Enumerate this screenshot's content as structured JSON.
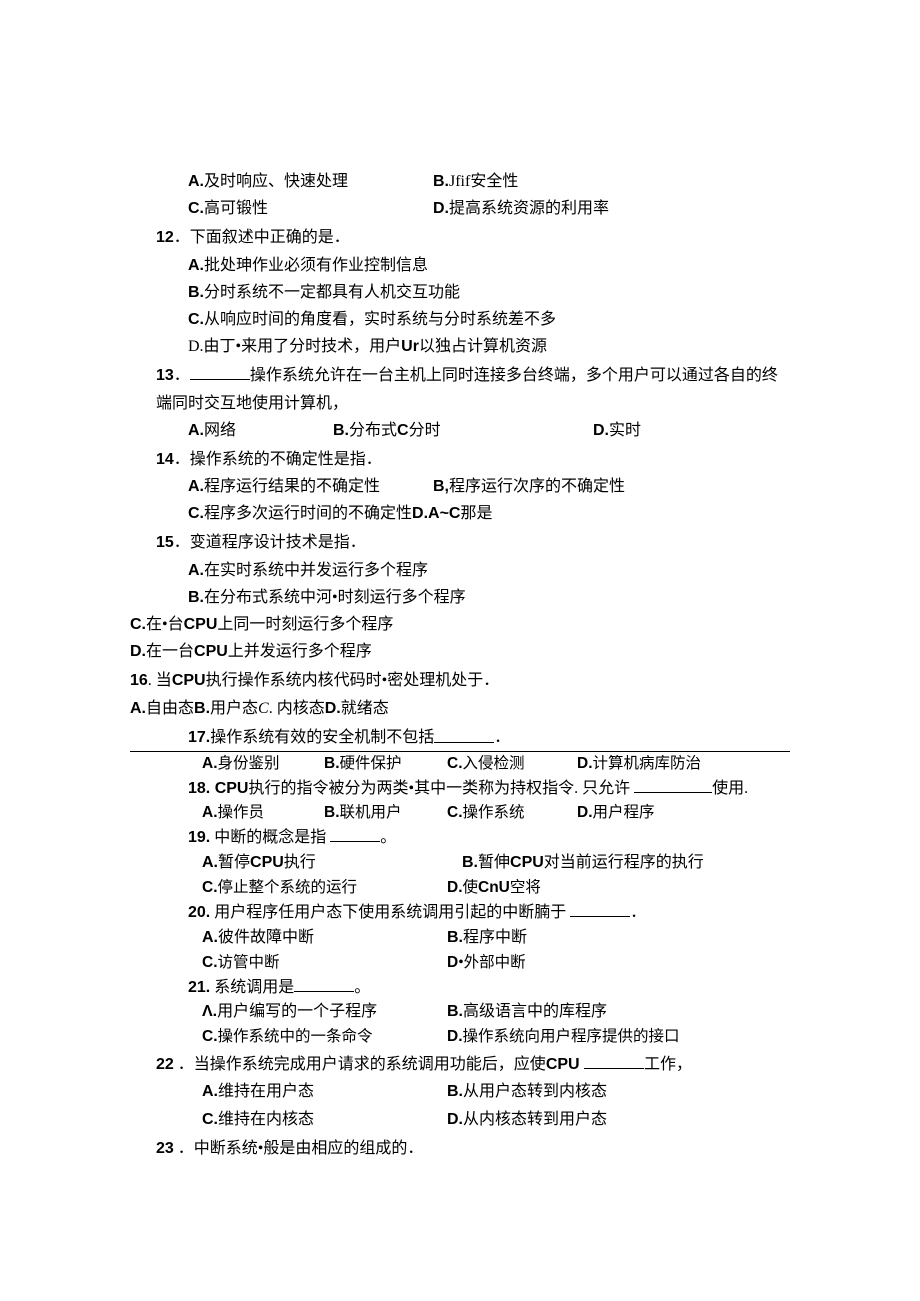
{
  "q11": {
    "optA": "及时响应、快速处理",
    "optB": "Jfif安全性",
    "optC": "高可锻性",
    "optD": "提高系统资源的利用率"
  },
  "q12": {
    "num": "12",
    "stem": "．下面叙述中正确的是．",
    "optA": "批处珅作业必须有作业控制信息",
    "optB": "分时系统不一定都具有人机交互功能",
    "optC": "从响应时间的角度看，实时系统与分时系统差不多",
    "optD_pre": "D.由丁•来用了分时技术，用户",
    "optD_bold": "Ur",
    "optD_post": "以独占计算机资源"
  },
  "q13": {
    "num": "13",
    "stem_pre": "．",
    "stem_post": "操作系统允许在一台主机上同时连接多台终端，多个用户可以通过各自的终端同时交互地使用计算机，",
    "optA": "网络",
    "optB_pre": "分布式",
    "optB_bold": "C",
    "optB_post": "分时",
    "optD": "实时"
  },
  "q14": {
    "num": "14",
    "stem": "．操作系统的不确定性是指．",
    "optA": "程序运行结果的不确定性",
    "optB": "程序运行次序的不确定性",
    "optC_pre": "程序多次运行时间的不确定性",
    "optC_bold": "D.A~C",
    "optC_post": "那是"
  },
  "q15": {
    "num": "15",
    "stem": "．变道程序设计技术是指．",
    "optA": "在实时系统中并发运行多个程序",
    "optB": "在分布式系统中河•时刻运行多个程序",
    "optC_pre": "在•台",
    "optC_bold": "CPU",
    "optC_post": "上同一时刻运行多个程序",
    "optD_pre": "在一台",
    "optD_bold": "CPU",
    "optD_post": "上并发运行多个程序"
  },
  "q16": {
    "num": "16",
    "stem_pre": ". 当",
    "stem_bold": "CPU",
    "stem_post": "执行操作系统内核代码时•密处理机处于．",
    "optA": "自由态",
    "optB": "用户态",
    "optC_pre": "C",
    "optC_post": ". 内核态",
    "optD": "就绪态"
  },
  "q17": {
    "num": "17.",
    "stem": " 操作系统有效的安全机制不包括 ",
    "stem_end": "．",
    "optA": "身份鉴别",
    "optB": "硬件保护",
    "optC": "入侵检测",
    "optD": "计算机病库防治"
  },
  "q18": {
    "num": "18.",
    "stem_pre": " CPU",
    "stem_mid": "执行的指令被分为两类•其中一类称为持权指令. 只允许 ",
    "stem_end": "使用.",
    "optA": "操作员",
    "optB": "联机用户",
    "optC": "操作系统",
    "optD": "用户程序"
  },
  "q19": {
    "num": "19.",
    "stem": " 中断的概念是指 ",
    "stem_end": "。",
    "optA_pre": "暂停",
    "optA_bold": "CPU",
    "optA_post": "执行",
    "optB_pre": "暂伸",
    "optB_bold": "CPU",
    "optB_post": "对当前运行程序的执行",
    "optC": "停止整个系统的运行",
    "optD_pre": "使",
    "optD_bold": "CnU",
    "optD_post": "空将"
  },
  "q20": {
    "num": "20.",
    "stem": " 用户程序任用户态下使用系统调用引起的中断腩于 ",
    "stem_end": "．",
    "optA": "彼件故障中断",
    "optB": "程序中断",
    "optC": "访管中断",
    "optD_pre": "D",
    "optD_post": "•外部中断"
  },
  "q21": {
    "num": "21.",
    "stem": " 系统调用是",
    "stem_end": "。",
    "optA_lbl": "Λ.",
    "optA": "用户编写的一个子程序",
    "optB": "高级语言中的库程序",
    "optC": "操作系统中的一条命令",
    "optD": "操作系统向用户程序提供的接口"
  },
  "q22": {
    "num": "22",
    "stem_pre": " ．当操作系统完成用户请求的系统调用功能后，应使",
    "stem_bold": "CPU ",
    "stem_end": "工作，",
    "optA": "维持在用户态",
    "optB": "从用户态转到内核态",
    "optC": "维持在内核态",
    "optD": "从内核态转到用户态"
  },
  "q23": {
    "num": "23",
    "stem": " ．中断系统•般是由相应的组成的．"
  }
}
